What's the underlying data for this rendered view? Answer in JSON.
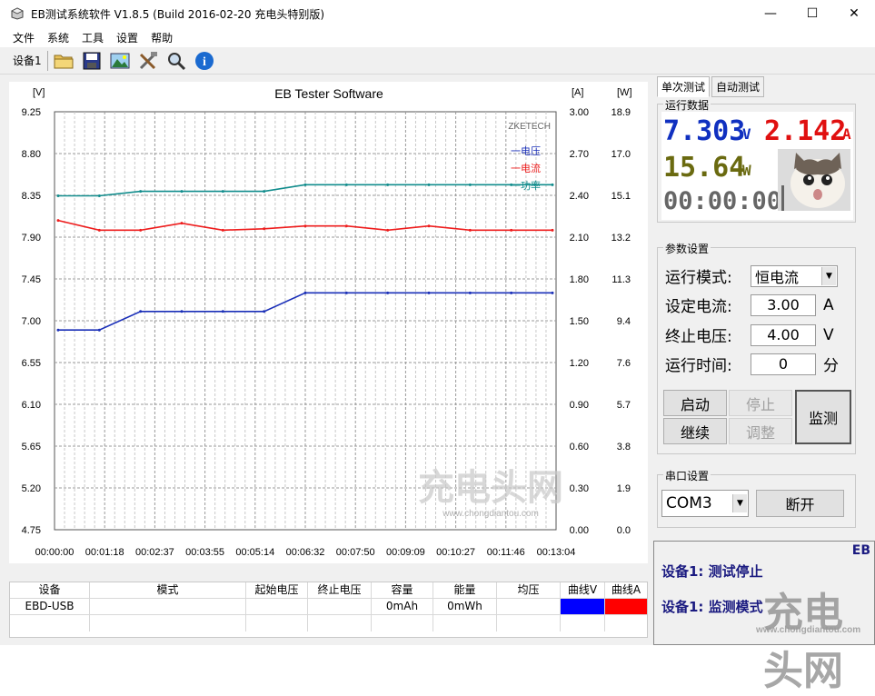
{
  "window": {
    "title": "EB测试系统软件 V1.8.5 (Build 2016-02-20 充电头特别版)",
    "controls": [
      "—",
      "☐",
      "✕"
    ]
  },
  "menu": [
    "文件",
    "系统",
    "工具",
    "设置",
    "帮助"
  ],
  "toolbar": {
    "device_label": "设备1",
    "icons": [
      "open-folder-icon",
      "save-icon",
      "image-icon",
      "tools-icon",
      "search-icon",
      "info-icon"
    ]
  },
  "chart": {
    "title": "EB Tester Software",
    "brand": "ZKETECH",
    "left_unit": "[V]",
    "mid_unit": "[A]",
    "right_unit": "[W]",
    "legend": [
      {
        "label": "一电压",
        "color": "#1a2fb8"
      },
      {
        "label": "一电流",
        "color": "#ee1c1c"
      },
      {
        "label": "一功率",
        "color": "#118c8c"
      }
    ],
    "watermark": "充电头网",
    "watermark_url": "www.chongdiantou.com"
  },
  "chart_data": {
    "type": "line",
    "x": [
      "00:00:00",
      "00:00:30",
      "00:01:18",
      "00:02:37",
      "00:03:55",
      "00:04:55",
      "00:05:14",
      "00:06:32",
      "00:07:50",
      "00:09:09",
      "00:10:27",
      "00:11:46",
      "00:13:04"
    ],
    "x_ticks": [
      "00:00:00",
      "00:01:18",
      "00:02:37",
      "00:03:55",
      "00:05:14",
      "00:06:32",
      "00:07:50",
      "00:09:09",
      "00:10:27",
      "00:11:46",
      "00:13:04"
    ],
    "y_left_ticks": [
      "9.25",
      "8.80",
      "8.35",
      "7.90",
      "7.45",
      "7.00",
      "6.55",
      "6.10",
      "5.65",
      "5.20",
      "4.75"
    ],
    "y_mid_ticks": [
      "3.00",
      "2.70",
      "2.40",
      "2.10",
      "1.80",
      "1.50",
      "1.20",
      "0.90",
      "0.60",
      "0.30",
      "0.00"
    ],
    "y_right_ticks": [
      "18.9",
      "17.0",
      "15.1",
      "13.2",
      "11.3",
      "9.4",
      "7.6",
      "5.7",
      "3.8",
      "1.9",
      "0.0"
    ],
    "ylim_left": [
      4.75,
      9.25
    ],
    "ylim_mid": [
      0,
      3.0
    ],
    "ylim_right": [
      0,
      18.9
    ],
    "series": [
      {
        "name": "电压",
        "axis": "left",
        "values": [
          6.9,
          6.9,
          7.1,
          7.1,
          7.1,
          7.1,
          7.3,
          7.3,
          7.3,
          7.3,
          7.3,
          7.3,
          7.3
        ]
      },
      {
        "name": "电流",
        "axis": "mid",
        "values": [
          2.22,
          2.15,
          2.15,
          2.2,
          2.15,
          2.16,
          2.18,
          2.18,
          2.15,
          2.18,
          2.15,
          2.15,
          2.15
        ]
      },
      {
        "name": "功率",
        "axis": "right",
        "values": [
          15.1,
          15.1,
          15.3,
          15.3,
          15.3,
          15.3,
          15.6,
          15.6,
          15.6,
          15.6,
          15.6,
          15.6,
          15.6
        ]
      }
    ],
    "grid": true
  },
  "table": {
    "headers": [
      "设备",
      "模式",
      "起始电压",
      "终止电压",
      "容量",
      "能量",
      "均压",
      "曲线V",
      "曲线A"
    ],
    "rows": [
      {
        "device": "EBD-USB",
        "mode": "",
        "start_v": "",
        "end_v": "",
        "capacity": "0mAh",
        "energy": "0mWh",
        "avg_v": "",
        "curve_v_color": "#0000ff",
        "curve_a_color": "#ff0000"
      }
    ]
  },
  "right": {
    "tabs": [
      "单次测试",
      "自动测试"
    ],
    "run_data": {
      "title": "运行数据",
      "voltage": "7.303",
      "voltage_unit": "V",
      "current": "2.142",
      "current_unit": "A",
      "power": "15.64",
      "power_unit": "W",
      "time": "00:00:00"
    },
    "params": {
      "title": "参数设置",
      "mode_label": "运行模式:",
      "mode_value": "恒电流",
      "set_current_label": "设定电流:",
      "set_current_value": "3.00",
      "set_current_unit": "A",
      "end_voltage_label": "终止电压:",
      "end_voltage_value": "4.00",
      "end_voltage_unit": "V",
      "run_time_label": "运行时间:",
      "run_time_value": "0",
      "run_time_unit": "分",
      "buttons": {
        "start": "启动",
        "stop": "停止",
        "continue": "继续",
        "adjust": "调整",
        "monitor": "监测"
      }
    },
    "serial": {
      "title": "串口设置",
      "port": "COM3",
      "disconnect": "断开"
    },
    "status": {
      "corner": "EB",
      "line1": "设备1: 测试停止",
      "line2": "设备1: 监测模式"
    },
    "watermark": "充电头网",
    "watermark_url": "www.chongdiantou.com"
  }
}
